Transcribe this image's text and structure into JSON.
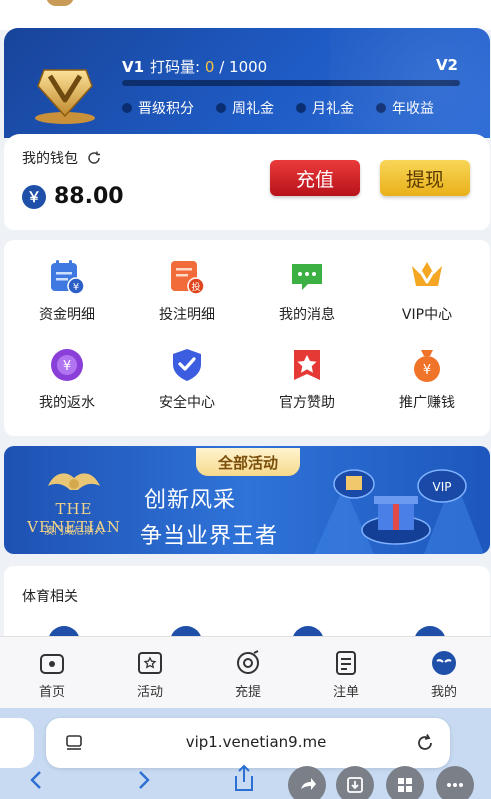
{
  "vip": {
    "current_level": "V1",
    "bet_label": "打码量:",
    "bet_current": "0",
    "bet_separator": " / ",
    "bet_target": "1000",
    "next_level": "V2",
    "progress_fraction": 0.0,
    "perks": [
      "晋级积分",
      "周礼金",
      "月礼金",
      "年收益"
    ]
  },
  "wallet": {
    "title": "我的钱包",
    "currency_symbol": "￥",
    "balance": "88.00",
    "deposit_label": "充值",
    "withdraw_label": "提现"
  },
  "menu": {
    "items": [
      {
        "label": "资金明细",
        "icon": "fund-details-icon"
      },
      {
        "label": "投注明细",
        "icon": "bet-details-icon"
      },
      {
        "label": "我的消息",
        "icon": "message-icon"
      },
      {
        "label": "VIP中心",
        "icon": "vip-crown-icon"
      },
      {
        "label": "我的返水",
        "icon": "rebate-chip-icon"
      },
      {
        "label": "安全中心",
        "icon": "shield-check-icon"
      },
      {
        "label": "官方赞助",
        "icon": "sponsor-star-icon"
      },
      {
        "label": "推广赚钱",
        "icon": "money-bag-icon"
      }
    ]
  },
  "banner": {
    "tag": "全部活动",
    "line1": "创新风采",
    "line2": "争当业界王者",
    "logo_name": "THE VENETIAN",
    "logo_sub": "澳门威尼斯人"
  },
  "sports": {
    "title": "体育相关"
  },
  "bottom_nav": {
    "items": [
      {
        "label": "首页",
        "icon": "home-icon"
      },
      {
        "label": "活动",
        "icon": "activity-icon"
      },
      {
        "label": "充提",
        "icon": "deposit-withdraw-icon"
      },
      {
        "label": "注单",
        "icon": "bet-slip-icon"
      },
      {
        "label": "我的",
        "icon": "profile-icon"
      }
    ]
  },
  "browser": {
    "url": "vip1.venetian9.me"
  },
  "colors": {
    "vip_blue": "#1f5bc4",
    "gold": "#f6c341",
    "deposit_red": "#d82a2f",
    "withdraw_yellow": "#f2c22c",
    "brand_blue": "#1f4fa8"
  }
}
